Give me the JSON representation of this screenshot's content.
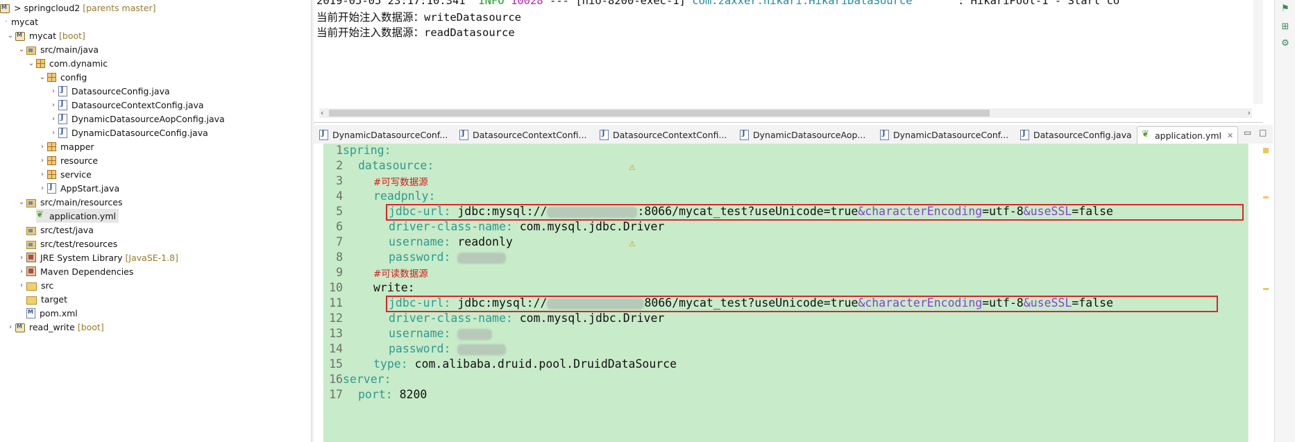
{
  "explorer": {
    "rows": [
      {
        "label": "springcloud2",
        "prefix": ">",
        "decoration": "[parents master]"
      },
      {
        "label": "mycat"
      },
      {
        "label": "mycat",
        "decoration": "[boot]"
      },
      {
        "label": "src/main/java"
      },
      {
        "label": "com.dynamic"
      },
      {
        "label": "config"
      },
      {
        "label": "DatasourceConfig.java"
      },
      {
        "label": "DatasourceContextConfig.java"
      },
      {
        "label": "DynamicDatasourceAopConfig.java"
      },
      {
        "label": "DynamicDatasourceConfig.java"
      },
      {
        "label": "mapper"
      },
      {
        "label": "resource"
      },
      {
        "label": "service"
      },
      {
        "label": "AppStart.java"
      },
      {
        "label": "src/main/resources"
      },
      {
        "label": "application.yml"
      },
      {
        "label": "src/test/java"
      },
      {
        "label": "src/test/resources"
      },
      {
        "label": "JRE System Library",
        "decoration": "[JavaSE-1.8]"
      },
      {
        "label": "Maven Dependencies"
      },
      {
        "label": "src"
      },
      {
        "label": "target"
      },
      {
        "label": "pom.xml"
      },
      {
        "label": "read_write",
        "decoration": "[boot]"
      }
    ]
  },
  "console": {
    "log_date": "2019-05-05 23:17:10.341",
    "log_level": "INFO",
    "log_pid": "10028",
    "log_sep": "---",
    "log_thread": "[nio-8200-exec-1]",
    "log_class": "com.zaxxer.hikari.HikariDataSource",
    "log_msg": ": HikariPool-1 - Start co",
    "line2": "当前开始注入数据源：writeDatasource",
    "line3": "当前开始注入数据源：readDatasource"
  },
  "tabs": [
    {
      "label": "DynamicDatasourceConf..."
    },
    {
      "label": "DatasourceContextConfi..."
    },
    {
      "label": "DatasourceContextConfi..."
    },
    {
      "label": "DynamicDatasourceAop..."
    },
    {
      "label": "DynamicDatasourceConf..."
    },
    {
      "label": "DatasourceConfig.java"
    },
    {
      "label": "application.yml",
      "active": true
    }
  ],
  "editor": {
    "line_numbers": [
      "1",
      "2",
      "3",
      "4",
      "5",
      "6",
      "7",
      "8",
      "9",
      "10",
      "11",
      "12",
      "13",
      "14",
      "15",
      "16",
      "17"
    ],
    "l1_key": "spring:",
    "l2_key": "datasource:",
    "l3_comment": "#可写数据源",
    "l4_key": "readpnly:",
    "l5_key": "jdbc-url:",
    "l5_pre": "jdbc:mysql://",
    "l5_post": ":8066/mycat_test?useUnicode=true",
    "l5_amp1": "&characterEncoding",
    "l5_mid": "=utf-8",
    "l5_amp2": "&useSSL",
    "l5_end": "=false",
    "l6_key": "driver-class-name:",
    "l6_val": "com.mysql.jdbc.Driver",
    "l7_key": "username:",
    "l7_val": "readonly",
    "l8_key": "password:",
    "l9_comment": "#可读数据源",
    "l10_key": "write:",
    "l11_key": "jdbc-url:",
    "l11_pre": "jdbc:mysql://",
    "l11_post": "8066/mycat_test?useUnicode=true",
    "l11_amp1": "&characterEncoding",
    "l11_mid": "=utf-8",
    "l11_amp2": "&useSSL",
    "l11_end": "=false",
    "l12_key": "driver-class-name:",
    "l12_val": "com.mysql.jdbc.Driver",
    "l13_key": "username:",
    "l14_key": "password:",
    "l15_key": "type:",
    "l15_val": "com.alibaba.druid.pool.DruidDataSource",
    "l16_key": "server:",
    "l17_key": "port:",
    "l17_val": "8200"
  },
  "colors": {
    "editor_bg": "#c8ebc9",
    "yaml_key": "#2e9a8f",
    "comment": "#d21919",
    "highlight_box": "#d8262b"
  }
}
